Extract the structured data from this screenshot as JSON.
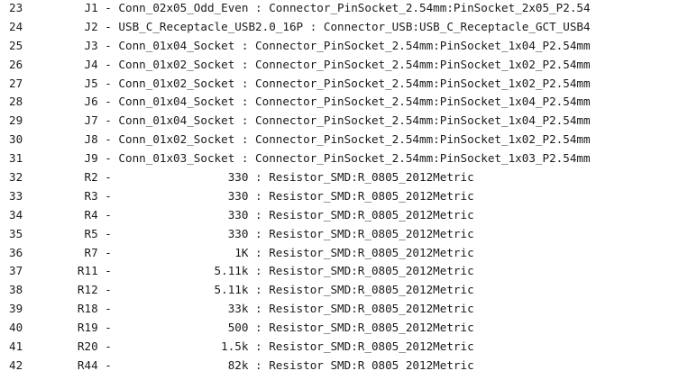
{
  "lines": [
    {
      "number": "23",
      "text": "      J1 - Conn_02x05_Odd_Even : Connector_PinSocket_2.54mm:PinSocket_2x05_P2.54"
    },
    {
      "number": "24",
      "text": "      J2 - USB_C_Receptacle_USB2.0_16P : Connector_USB:USB_C_Receptacle_GCT_USB4"
    },
    {
      "number": "25",
      "text": "      J3 - Conn_01x04_Socket : Connector_PinSocket_2.54mm:PinSocket_1x04_P2.54mm"
    },
    {
      "number": "26",
      "text": "      J4 - Conn_01x02_Socket : Connector_PinSocket_2.54mm:PinSocket_1x02_P2.54mm"
    },
    {
      "number": "27",
      "text": "      J5 - Conn_01x02_Socket : Connector_PinSocket_2.54mm:PinSocket_1x02_P2.54mm"
    },
    {
      "number": "28",
      "text": "      J6 - Conn_01x04_Socket : Connector_PinSocket_2.54mm:PinSocket_1x04_P2.54mm"
    },
    {
      "number": "29",
      "text": "      J7 - Conn_01x04_Socket : Connector_PinSocket_2.54mm:PinSocket_1x04_P2.54mm"
    },
    {
      "number": "30",
      "text": "      J8 - Conn_01x02_Socket : Connector_PinSocket_2.54mm:PinSocket_1x02_P2.54mm"
    },
    {
      "number": "31",
      "text": "      J9 - Conn_01x03_Socket : Connector_PinSocket_2.54mm:PinSocket_1x03_P2.54mm"
    },
    {
      "number": "32",
      "text": "      R2 -                 330 : Resistor_SMD:R_0805_2012Metric"
    },
    {
      "number": "33",
      "text": "      R3 -                 330 : Resistor_SMD:R_0805_2012Metric"
    },
    {
      "number": "34",
      "text": "      R4 -                 330 : Resistor_SMD:R_0805_2012Metric"
    },
    {
      "number": "35",
      "text": "      R5 -                 330 : Resistor_SMD:R_0805_2012Metric"
    },
    {
      "number": "36",
      "text": "      R7 -                  1K : Resistor_SMD:R_0805_2012Metric"
    },
    {
      "number": "37",
      "text": "     R11 -               5.11k : Resistor_SMD:R_0805_2012Metric"
    },
    {
      "number": "38",
      "text": "     R12 -               5.11k : Resistor_SMD:R_0805_2012Metric"
    },
    {
      "number": "39",
      "text": "     R18 -                 33k : Resistor_SMD:R_0805_2012Metric"
    },
    {
      "number": "40",
      "text": "     R19 -                 500 : Resistor_SMD:R_0805_2012Metric"
    },
    {
      "number": "41",
      "text": "     R20 -                1.5k : Resistor_SMD:R_0805_2012Metric"
    },
    {
      "number": "42",
      "text": "     R44 -                 82k : Resistor_SMD:R_0805_2012Metric"
    }
  ]
}
